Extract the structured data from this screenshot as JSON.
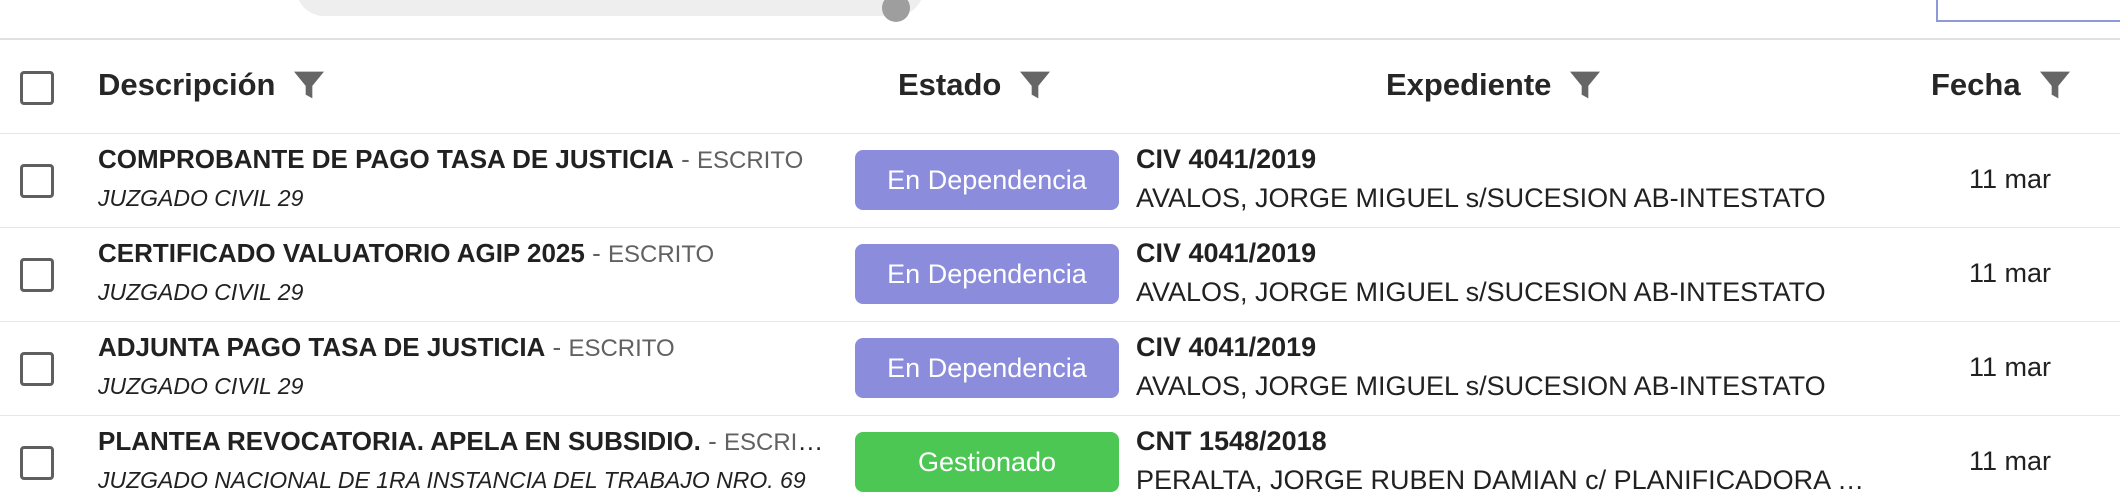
{
  "colors": {
    "en_dependencia": "#8b8cdc",
    "gestionado": "#4cc754"
  },
  "header": {
    "descripcion": "Descripción",
    "estado": "Estado",
    "expediente": "Expediente",
    "fecha": "Fecha"
  },
  "rows": [
    {
      "title": "COMPROBANTE DE PAGO TASA DE JUSTICIA",
      "sep": " - ",
      "type": "ESCRITO",
      "court": "JUZGADO CIVIL 29",
      "status": "En Dependencia",
      "status_color": "en_dependencia",
      "expediente": "CIV 4041/2019",
      "caratula": "AVALOS, JORGE MIGUEL s/SUCESION AB-INTESTATO",
      "fecha": "11 mar"
    },
    {
      "title": "CERTIFICADO VALUATORIO AGIP 2025",
      "sep": " - ",
      "type": "ESCRITO",
      "court": "JUZGADO CIVIL 29",
      "status": "En Dependencia",
      "status_color": "en_dependencia",
      "expediente": "CIV 4041/2019",
      "caratula": "AVALOS, JORGE MIGUEL s/SUCESION AB-INTESTATO",
      "fecha": "11 mar"
    },
    {
      "title": "ADJUNTA PAGO TASA DE JUSTICIA",
      "sep": " - ",
      "type": "ESCRITO",
      "court": "JUZGADO CIVIL 29",
      "status": "En Dependencia",
      "status_color": "en_dependencia",
      "expediente": "CIV 4041/2019",
      "caratula": "AVALOS, JORGE MIGUEL s/SUCESION AB-INTESTATO",
      "fecha": "11 mar"
    },
    {
      "title": "PLANTEA REVOCATORIA. APELA EN SUBSIDIO.",
      "sep": " - ",
      "type": "ESCRITO",
      "court": "JUZGADO NACIONAL DE 1RA INSTANCIA DEL TRABAJO NRO. 69",
      "status": "Gestionado",
      "status_color": "gestionado",
      "expediente": "CNT 1548/2018",
      "caratula": "PERALTA, JORGE RUBEN DAMIAN c/ PLANIFICADORA DE SERVICIOS",
      "fecha": "11 mar"
    }
  ]
}
